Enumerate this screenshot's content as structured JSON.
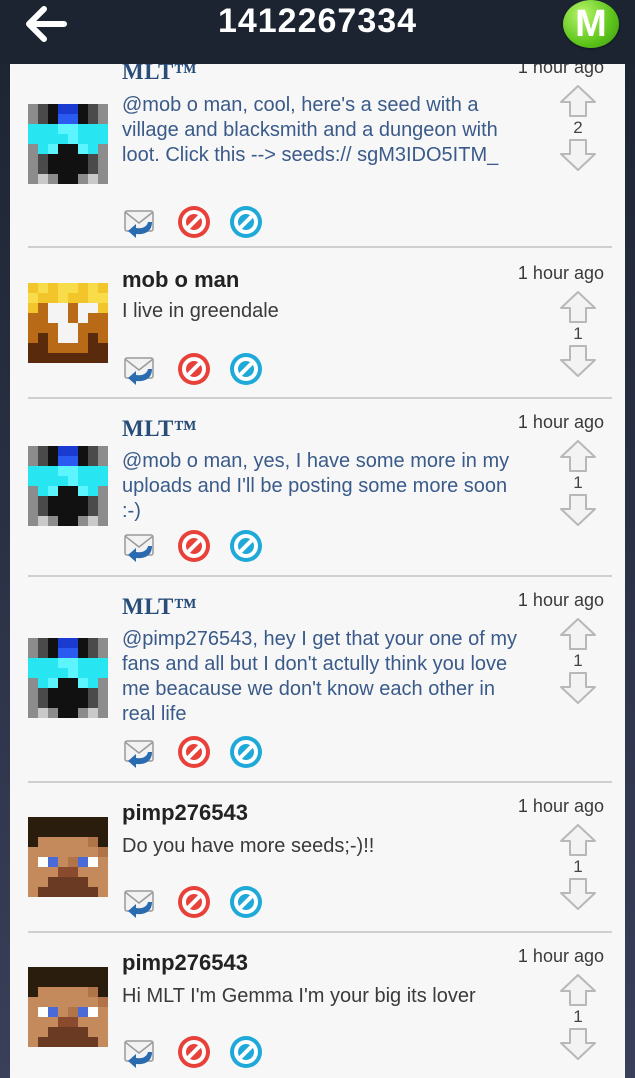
{
  "header": {
    "title": "1412267334",
    "menu_letter": "M"
  },
  "comments": [
    {
      "author": "MLT™",
      "time": "1 hour ago",
      "text": "@mob o man, cool, here's a seed with a village and blacksmith and a dungeon with loot. Click this --> seeds:// sgM3IDO5ITM_",
      "score": "2",
      "avatar": "mlt"
    },
    {
      "author": "mob o man",
      "time": "1 hour ago",
      "text": "I live in greendale",
      "score": "1",
      "avatar": "mob"
    },
    {
      "author": "MLT™",
      "time": "1 hour ago",
      "text": "@mob o man, yes, I have some more in my uploads and I'll be posting some more soon :-)",
      "score": "1",
      "avatar": "mlt"
    },
    {
      "author": "MLT™",
      "time": "1 hour ago",
      "text": "@pimp276543, hey I get that your one of my fans and all but I don't actully think you love me beacause we don't know each other in real life",
      "score": "1",
      "avatar": "mlt"
    },
    {
      "author": "pimp276543",
      "time": "1 hour ago",
      "text": "Do you have more seeds;-)!!",
      "score": "1",
      "avatar": "steve"
    },
    {
      "author": "pimp276543",
      "time": "1 hour ago",
      "text": "Hi MLT I'm Gemma I'm your big its lover",
      "score": "1",
      "avatar": "steve"
    }
  ],
  "colors": {
    "header_bg": "#1b2430",
    "list_bg": "#f7f7f7",
    "menu_green": "#5cc41a",
    "reply_blue": "#2a6bb0",
    "block_red": "#e8413a",
    "report_cyan": "#1ea9d8"
  }
}
